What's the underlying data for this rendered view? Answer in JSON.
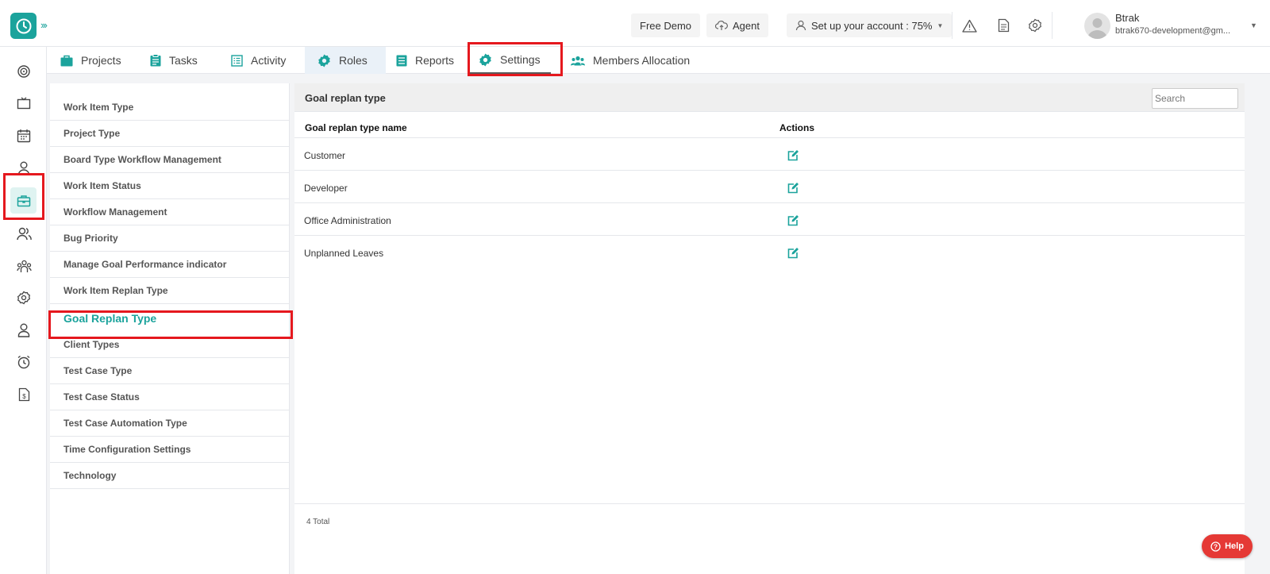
{
  "topbar": {
    "free_demo": "Free Demo",
    "agent": "Agent",
    "setup": "Set up your account : 75%",
    "user_name": "Btrak",
    "user_email": "btrak670-development@gm..."
  },
  "tabs": [
    {
      "label": "Projects",
      "icon": "briefcase-icon"
    },
    {
      "label": "Tasks",
      "icon": "clipboard-icon"
    },
    {
      "label": "Activity",
      "icon": "list-icon"
    },
    {
      "label": "Roles",
      "icon": "gear-icon"
    },
    {
      "label": "Reports",
      "icon": "document-icon"
    },
    {
      "label": "Settings",
      "icon": "gear-icon"
    },
    {
      "label": "Members Allocation",
      "icon": "users-icon"
    }
  ],
  "settings_list": [
    "Work Item Type",
    "Project Type",
    "Board Type Workflow Management",
    "Work Item Status",
    "Workflow Management",
    "Bug Priority",
    "Manage Goal Performance indicator",
    "Work Item Replan Type",
    "Goal Replan Type",
    "Client Types",
    "Test Case Type",
    "Test Case Status",
    "Test Case Automation Type",
    "Time Configuration Settings",
    "Technology"
  ],
  "panel": {
    "title": "Goal replan type",
    "search_placeholder": "Search",
    "col_name": "Goal replan type name",
    "col_actions": "Actions",
    "rows": [
      "Customer",
      "Developer",
      "Office Administration",
      "Unplanned Leaves"
    ],
    "total": "4 Total"
  },
  "help": "Help",
  "colors": {
    "accent": "#1ba39c",
    "highlight": "#e5181e",
    "help": "#e53935"
  }
}
